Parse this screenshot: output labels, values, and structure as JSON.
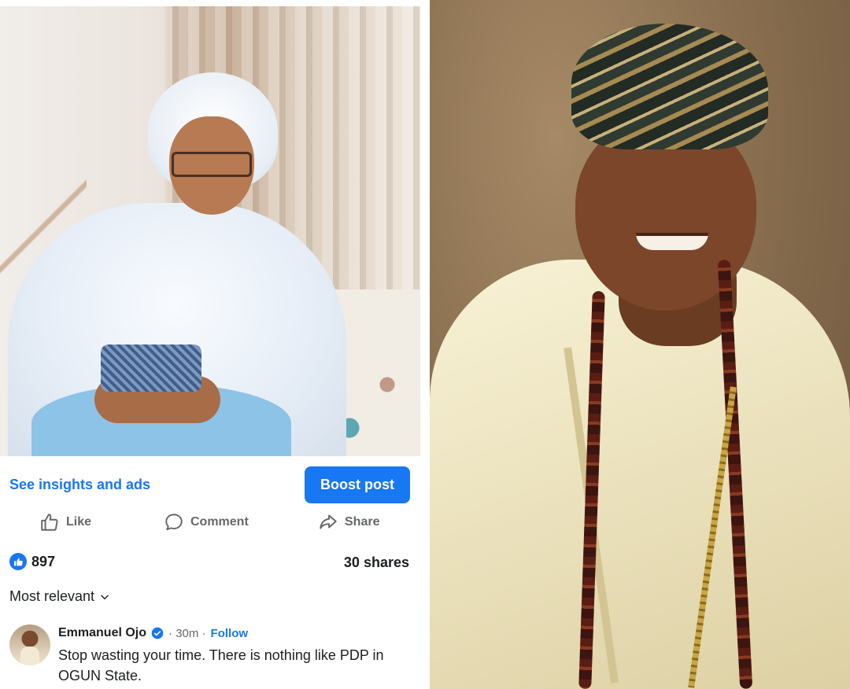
{
  "post": {
    "insights_label": "See insights and ads",
    "boost_label": "Boost post",
    "like_label": "Like",
    "comment_label": "Comment",
    "share_label": "Share",
    "reaction_count": "897",
    "shares_label": "30 shares",
    "sort_label": "Most relevant"
  },
  "comment": {
    "author": "Emmanuel Ojo",
    "time": "· 30m ·",
    "follow_label": "Follow",
    "text": "Stop wasting your time. There is nothing like PDP in OGUN State."
  },
  "icons": {
    "like": "thumbs-up-icon",
    "comment": "speech-bubble-icon",
    "share": "share-arrow-icon",
    "reaction": "like-badge-icon",
    "sort": "chevron-down-icon",
    "verified": "verified-badge-icon"
  },
  "colors": {
    "accent": "#1877f2",
    "muted_text": "#65676b",
    "text": "#1c1e21"
  }
}
